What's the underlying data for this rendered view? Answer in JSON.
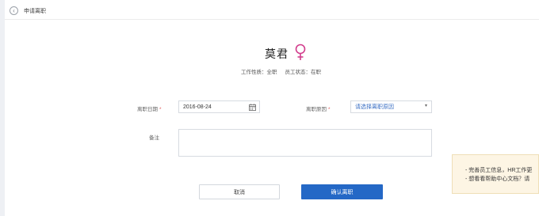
{
  "header": {
    "title": "申请离职"
  },
  "employee": {
    "name": "莫君",
    "gender_symbol": "♀",
    "work_type_label": "工作性质：全职",
    "status_label": "员工状态：在职"
  },
  "form": {
    "leave_date": {
      "label": "离职日期",
      "required": "*",
      "value": "2016-08-24"
    },
    "leave_reason": {
      "label": "离职原因",
      "required": "*",
      "placeholder": "请选择离职原因"
    },
    "remark": {
      "label": "备注",
      "value": ""
    }
  },
  "buttons": {
    "cancel": "取消",
    "confirm": "确认离职"
  },
  "toast": {
    "line1": "- 完善员工信息，HR工作更",
    "line2": "- 想看看帮助中心文档？请"
  },
  "colors": {
    "primary": "#2468c6",
    "gender": "#d23c8c",
    "required": "#e05a5a",
    "toast_bg": "#fdf5e4"
  }
}
